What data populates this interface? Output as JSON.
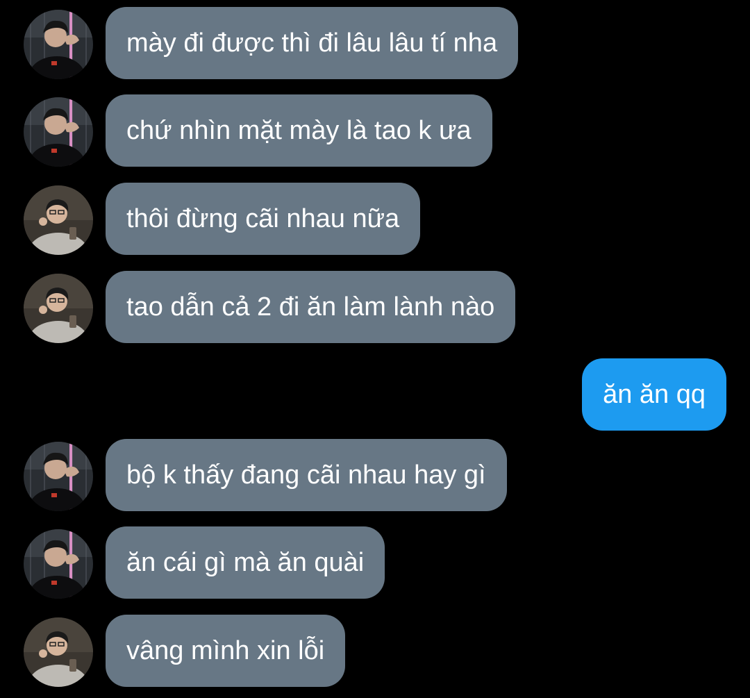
{
  "colors": {
    "background": "#000000",
    "incoming_bubble": "#677785",
    "outgoing_bubble": "#1d9bf0",
    "text": "#ffffff"
  },
  "messages": [
    {
      "direction": "incoming",
      "avatar": "avatar-user-a",
      "text": "mày đi được thì đi lâu lâu tí nha"
    },
    {
      "direction": "incoming",
      "avatar": "avatar-user-a",
      "text": "chứ nhìn mặt mày là tao k ưa"
    },
    {
      "direction": "incoming",
      "avatar": "avatar-user-b",
      "text": "thôi đừng cãi nhau nữa"
    },
    {
      "direction": "incoming",
      "avatar": "avatar-user-b",
      "text": "tao dẫn cả 2 đi ăn làm lành nào"
    },
    {
      "direction": "outgoing",
      "text": "ăn ăn qq"
    },
    {
      "direction": "incoming",
      "avatar": "avatar-user-a",
      "text": "bộ k thấy đang cãi nhau hay gì"
    },
    {
      "direction": "incoming",
      "avatar": "avatar-user-a",
      "text": "ăn cái gì mà ăn quài"
    },
    {
      "direction": "incoming",
      "avatar": "avatar-user-b",
      "text": "vâng mình xin lỗi"
    }
  ]
}
